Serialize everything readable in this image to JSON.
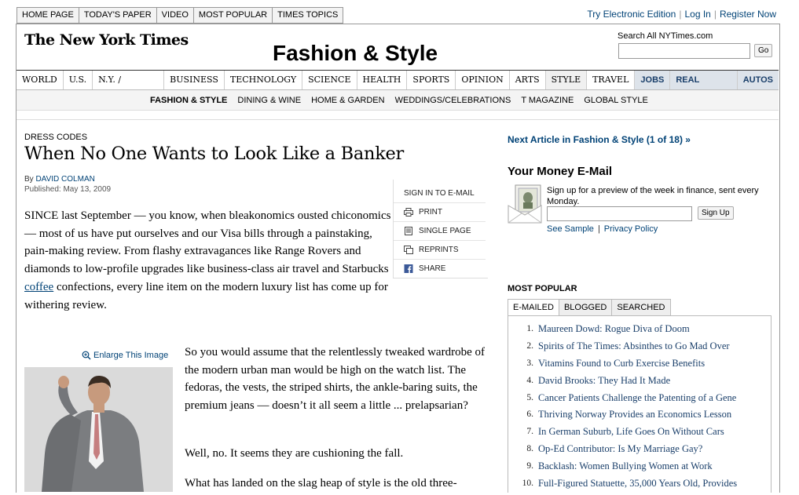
{
  "top_nav": [
    "HOME PAGE",
    "TODAY'S PAPER",
    "VIDEO",
    "MOST POPULAR",
    "TIMES TOPICS"
  ],
  "account": {
    "electronic": "Try Electronic Edition",
    "login": "Log In",
    "register": "Register Now"
  },
  "logo": "The New York Times",
  "section_title": "Fashion & Style",
  "search": {
    "label": "Search All NYTimes.com",
    "go": "Go"
  },
  "main_nav": [
    "WORLD",
    "U.S.",
    "N.Y. / REGION",
    "BUSINESS",
    "TECHNOLOGY",
    "SCIENCE",
    "HEALTH",
    "SPORTS",
    "OPINION",
    "ARTS",
    "STYLE",
    "TRAVEL",
    "JOBS",
    "REAL ESTATE",
    "AUTOS"
  ],
  "sub_nav": [
    "FASHION & STYLE",
    "DINING & WINE",
    "HOME & GARDEN",
    "WEDDINGS/CELEBRATIONS",
    "T MAGAZINE",
    "GLOBAL STYLE"
  ],
  "article": {
    "kicker": "DRESS CODES",
    "headline": "When No One Wants to Look Like a Banker",
    "by_prefix": "By ",
    "author": "DAVID COLMAN",
    "published": "Published: May 13, 2009",
    "p1_a": "SINCE last September — you know, when bleakonomics ousted chiconomics — most of us have put ourselves and our Visa bills through a painstaking, pain-making review. From flashy extravagances like Range Rovers and diamonds to low-profile upgrades like business-class air travel and Starbucks ",
    "p1_link": "coffee",
    "p1_b": " confections, every line item on the modern luxury list has come up for withering review.",
    "enlarge": "Enlarge This Image",
    "p2": "So you would assume that the relentlessly tweaked wardrobe of the modern urban man would be high on the watch list. The fedoras, the vests, the striped shirts, the ankle-baring suits, the premium jeans — doesn’t it all seem a little ... prelapsarian?",
    "p3": "Well, no. It seems they are cushioning the fall.",
    "p4": "What has landed on the slag heap of style is the old three-"
  },
  "tools": {
    "signin": "SIGN IN TO E-MAIL",
    "print": "PRINT",
    "single": "SINGLE PAGE",
    "reprints": "REPRINTS",
    "share": "SHARE"
  },
  "next_article": "Next Article in Fashion & Style (1 of 18) »",
  "your_money": {
    "title": "Your Money E-Mail",
    "text": "Sign up for a preview of the week in finance, sent every Monday.",
    "button": "Sign Up",
    "sample": "See Sample",
    "privacy": "Privacy Policy"
  },
  "most_popular": {
    "title": "MOST POPULAR",
    "tabs": [
      "E-MAILED",
      "BLOGGED",
      "SEARCHED"
    ],
    "items": [
      {
        "n": "1.",
        "t": "Maureen Dowd: Rogue Diva of Doom"
      },
      {
        "n": "2.",
        "t": "Spirits of The Times: Absinthes to Go Mad Over"
      },
      {
        "n": "3.",
        "t": "Vitamins Found to Curb Exercise Benefits"
      },
      {
        "n": "4.",
        "t": "David Brooks: They Had It Made"
      },
      {
        "n": "5.",
        "t": "Cancer Patients Challenge the Patenting of a Gene"
      },
      {
        "n": "6.",
        "t": "Thriving Norway Provides an Economics Lesson"
      },
      {
        "n": "7.",
        "t": "In German Suburb, Life Goes On Without Cars"
      },
      {
        "n": "8.",
        "t": "Op-Ed Contributor: Is My Marriage Gay?"
      },
      {
        "n": "9.",
        "t": "Backlash: Women Bullying Women at Work"
      },
      {
        "n": "10.",
        "t": "Full-Figured Statuette, 35,000 Years Old, Provides"
      }
    ]
  }
}
